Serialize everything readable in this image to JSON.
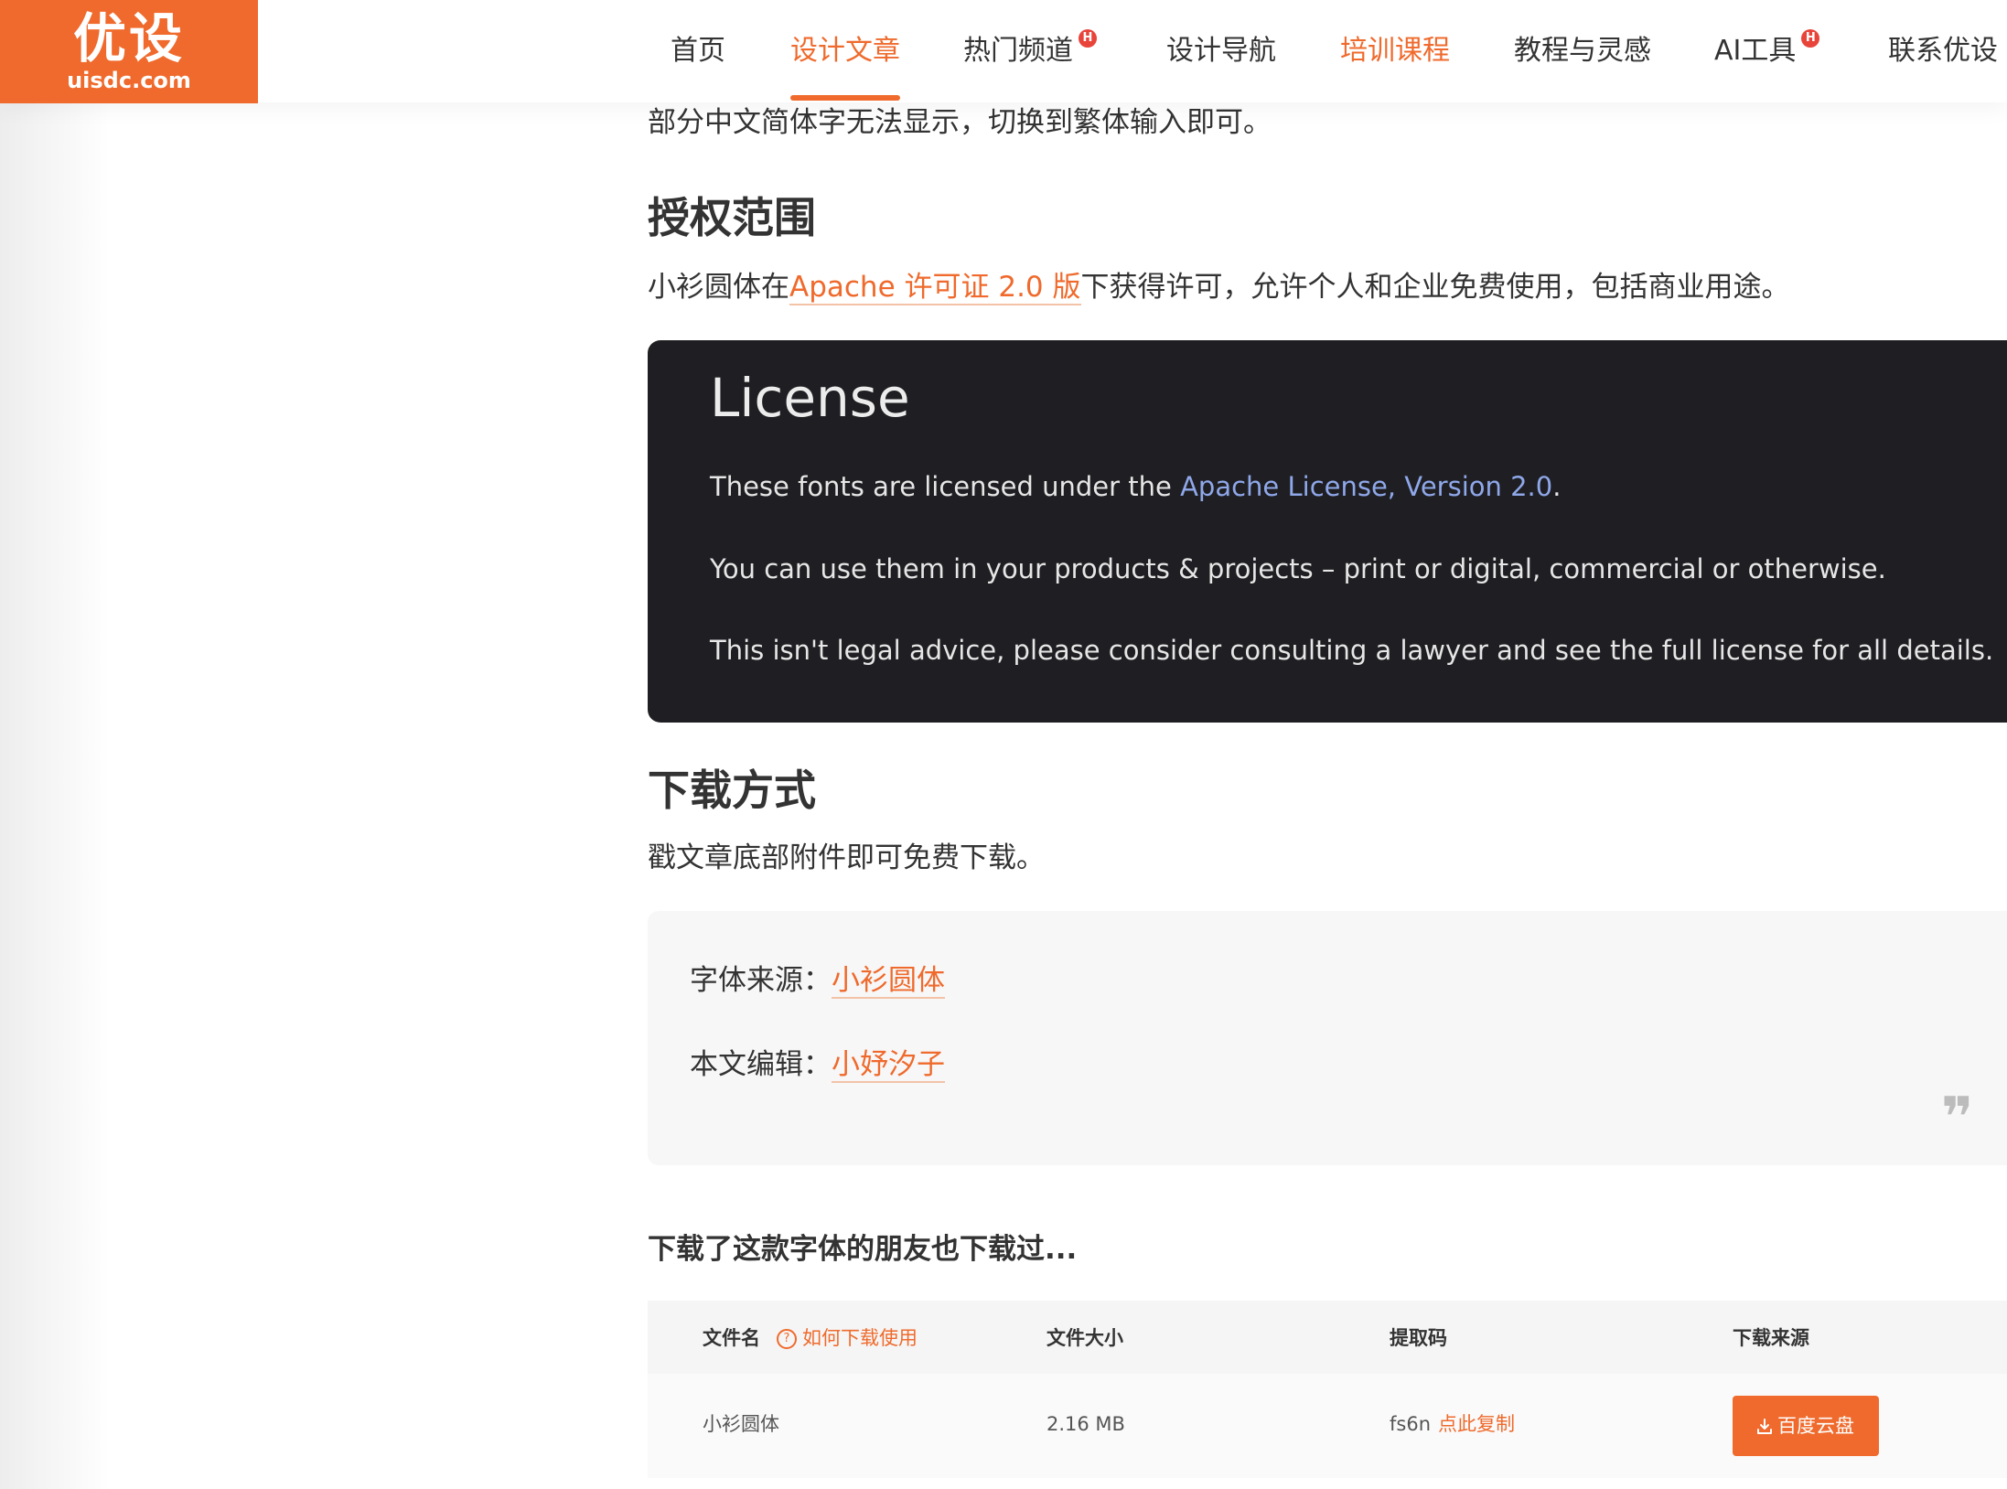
{
  "header": {
    "logo_main": "优设",
    "logo_sub": "uisdc.com",
    "nav": [
      {
        "label": "首页"
      },
      {
        "label": "设计文章"
      },
      {
        "label": "热门频道",
        "badge": "H"
      },
      {
        "label": "设计导航"
      },
      {
        "label": "培训课程"
      },
      {
        "label": "教程与灵感"
      },
      {
        "label": "AI工具",
        "badge": "H"
      },
      {
        "label": "联系优设"
      }
    ]
  },
  "article": {
    "top_para": "部分中文简体字无法显示，切换到繁体输入即可。",
    "license_heading": "授权范围",
    "license_para_pre": "小衫圆体在",
    "license_para_link": "Apache 许可证 2.0 版",
    "license_para_post": "下获得许可，允许个人和企业免费使用，包括商业用途。",
    "license_box": {
      "title": "License",
      "line1_pre": "These fonts are licensed under the ",
      "line1_link": "Apache License, Version 2.0",
      "line1_post": ".",
      "line2": "You can use them in your products & projects – print or digital, commercial or otherwise.",
      "line3": "This isn't legal advice, please consider consulting a lawyer and see the full license for all details."
    },
    "download_heading": "下载方式",
    "download_para": "戳文章底部附件即可免费下载。",
    "quote": {
      "source_label": "字体来源：",
      "source_link": "小衫圆体",
      "editor_label": "本文编辑：",
      "editor_link": "小妤汐子",
      "mark": "❞"
    },
    "related_heading": "下载了这款字体的朋友也下载过..."
  },
  "download_table": {
    "headers": {
      "filename": "文件名",
      "help": "如何下载使用",
      "size": "文件大小",
      "code": "提取码",
      "source": "下载来源"
    },
    "row": {
      "filename": "小衫圆体",
      "size": "2.16 MB",
      "code": "fs6n",
      "copy": "点此复制",
      "button": "百度云盘"
    }
  }
}
